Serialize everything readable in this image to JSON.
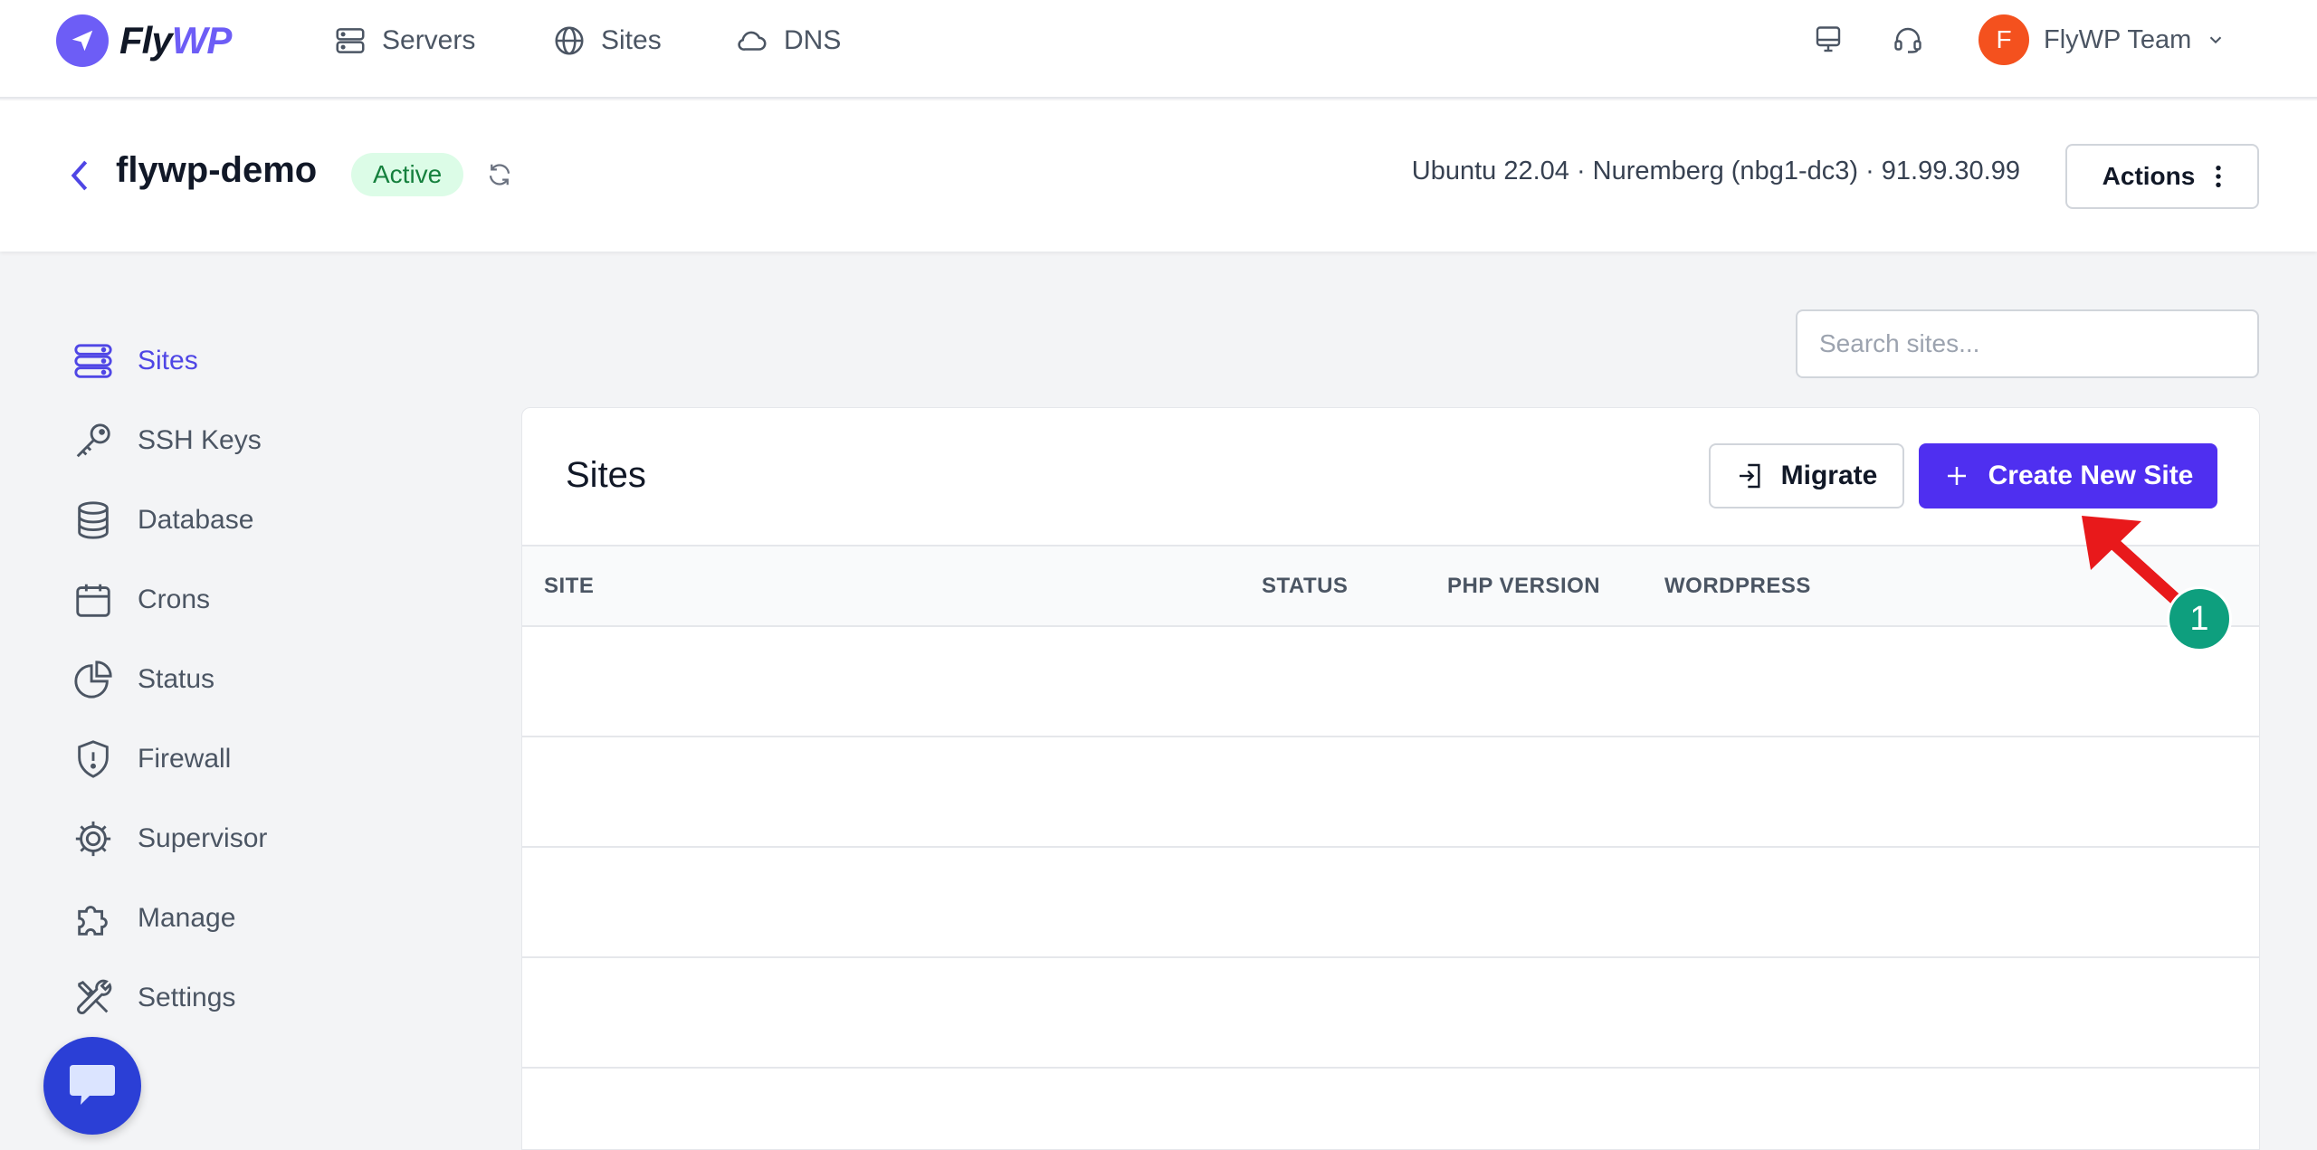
{
  "brand": {
    "name_part1": "Fly",
    "name_part2": "WP"
  },
  "topnav": {
    "items": [
      {
        "label": "Servers",
        "icon": "server-icon"
      },
      {
        "label": "Sites",
        "icon": "globe-icon"
      },
      {
        "label": "DNS",
        "icon": "cloud-icon"
      }
    ],
    "user": {
      "avatar_initial": "F",
      "name": "FlyWP Team"
    }
  },
  "server": {
    "name": "flywp-demo",
    "status": "Active",
    "meta": "Ubuntu 22.04 · Nuremberg (nbg1-dc3) · 91.99.30.99",
    "actions_label": "Actions"
  },
  "sidebar": {
    "items": [
      {
        "label": "Sites",
        "icon": "sites-icon",
        "active": true
      },
      {
        "label": "SSH Keys",
        "icon": "key-icon"
      },
      {
        "label": "Database",
        "icon": "database-icon"
      },
      {
        "label": "Crons",
        "icon": "calendar-icon"
      },
      {
        "label": "Status",
        "icon": "pie-chart-icon"
      },
      {
        "label": "Firewall",
        "icon": "shield-icon"
      },
      {
        "label": "Supervisor",
        "icon": "cog-icon"
      },
      {
        "label": "Manage",
        "icon": "puzzle-icon"
      },
      {
        "label": "Settings",
        "icon": "tools-icon"
      }
    ]
  },
  "search": {
    "placeholder": "Search sites...",
    "value": ""
  },
  "sites_card": {
    "title": "Sites",
    "migrate_label": "Migrate",
    "create_label": "Create New Site",
    "columns": [
      "SITE",
      "STATUS",
      "PHP VERSION",
      "WORDPRESS"
    ],
    "rows": []
  },
  "annotation": {
    "step": "1",
    "color": "#e8191b",
    "badge_color": "#0e9f7e"
  },
  "colors": {
    "accent": "#4f2ff0",
    "active_text": "#4f46e5",
    "status_bg": "#dcfce7",
    "status_text": "#15803d"
  }
}
